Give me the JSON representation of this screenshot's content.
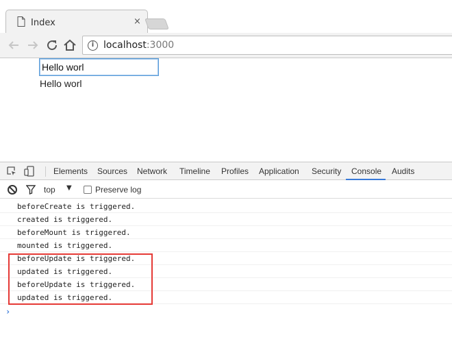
{
  "browser": {
    "tab_title": "Index",
    "tab_close": "×",
    "url_host": "localhost",
    "url_port": ":3000",
    "icons": [
      "page-icon",
      "back-arrow-icon",
      "forward-arrow-icon",
      "reload-icon",
      "home-icon",
      "info-icon"
    ]
  },
  "page": {
    "input_value": "Hello worl",
    "mirror_text": "Hello worl"
  },
  "devtools": {
    "tabs": [
      "Elements",
      "Sources",
      "Network",
      "Timeline",
      "Profiles",
      "Application",
      "Security",
      "Console",
      "Audits"
    ],
    "active_tab": "Console",
    "context": "top",
    "context_arrow": "▼",
    "preserve_log_label": "Preserve log",
    "preserve_log_checked": false,
    "console_lines": [
      "beforeCreate is triggered.",
      "created is triggered.",
      "beforeMount is triggered.",
      "mounted is triggered.",
      "beforeUpdate is triggered.",
      "updated is triggered.",
      "beforeUpdate is triggered.",
      "updated is triggered."
    ],
    "prompt": "›"
  },
  "colors": {
    "highlight": "#e53935",
    "devtools_active": "#3879d9"
  }
}
